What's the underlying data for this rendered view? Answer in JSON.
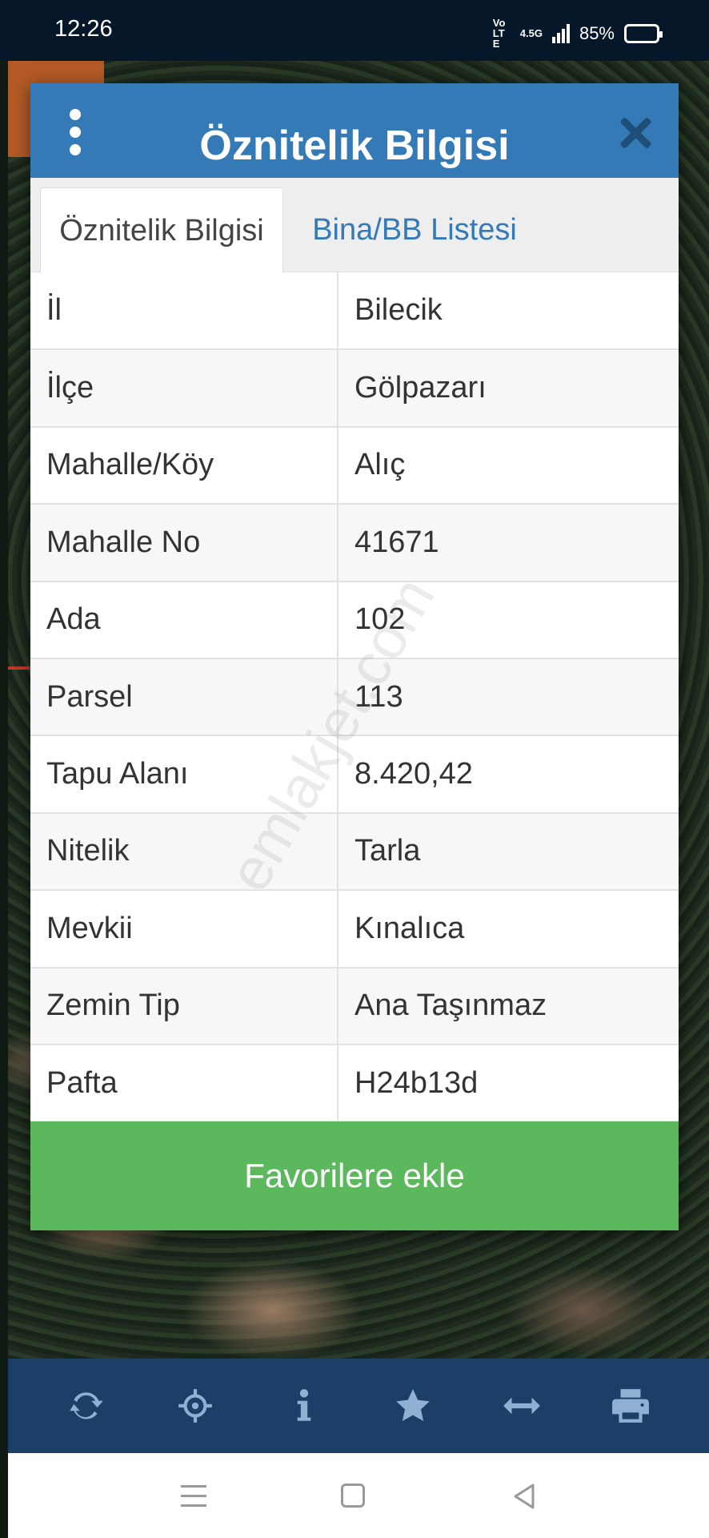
{
  "status_bar": {
    "time": "12:26",
    "volte_label": "Vo LTE",
    "network_label": "4.5G",
    "battery_percent": "85%",
    "battery_level": 0.85
  },
  "dialog": {
    "title": "Öznitelik Bilgisi",
    "tabs": [
      {
        "label": "Öznitelik Bilgisi",
        "active": true
      },
      {
        "label": "Bina/BB Listesi",
        "active": false
      }
    ],
    "rows": [
      {
        "key": "İl",
        "value": "Bilecik"
      },
      {
        "key": "İlçe",
        "value": "Gölpazarı"
      },
      {
        "key": "Mahalle/Köy",
        "value": "Alıç"
      },
      {
        "key": "Mahalle No",
        "value": "41671"
      },
      {
        "key": "Ada",
        "value": "102"
      },
      {
        "key": "Parsel",
        "value": "113"
      },
      {
        "key": "Tapu Alanı",
        "value": "8.420,42"
      },
      {
        "key": "Nitelik",
        "value": "Tarla"
      },
      {
        "key": "Mevkii",
        "value": "Kınalıca"
      },
      {
        "key": "Zemin Tip",
        "value": "Ana Taşınmaz"
      },
      {
        "key": "Pafta",
        "value": "H24b13d"
      }
    ],
    "favorite_button": "Favorilere ekle"
  },
  "watermark": "emlakjet.com",
  "toolbar": {
    "icons": [
      "refresh-icon",
      "crosshair-icon",
      "info-icon",
      "star-icon",
      "measure-arrows-icon",
      "print-icon"
    ]
  },
  "colors": {
    "header": "#337ab7",
    "tab_link": "#337ab7",
    "favorite_button": "#5cb85c",
    "toolbar": "#1b3f66",
    "status_bar": "#07172a"
  }
}
